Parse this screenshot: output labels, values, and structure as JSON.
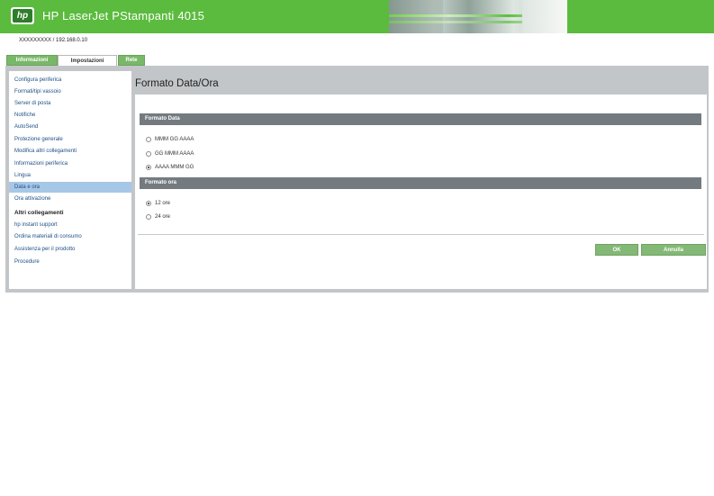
{
  "header": {
    "logo_text": "hp",
    "title": "HP LaserJet PStampanti 4015"
  },
  "device_address": "XXXXXXXXX / 192.168.0.10",
  "tabs": [
    {
      "label": "Informazioni"
    },
    {
      "label": "Impostazioni"
    },
    {
      "label": "Rete"
    }
  ],
  "sidebar": {
    "items": [
      {
        "label": "Configura periferica"
      },
      {
        "label": "Formati/tipi vassoio"
      },
      {
        "label": "Server di posta"
      },
      {
        "label": "Notifiche"
      },
      {
        "label": "AutoSend"
      },
      {
        "label": "Protezione generale"
      },
      {
        "label": "Modifica altri collegamenti"
      },
      {
        "label": "Informazioni periferica"
      },
      {
        "label": "Lingua"
      },
      {
        "label": "Data e ora"
      },
      {
        "label": "Ora attivazione"
      }
    ],
    "other_heading": "Altri collegamenti",
    "other_items": [
      {
        "label": "hp instant support"
      },
      {
        "label": "Ordina materiali di consumo"
      },
      {
        "label": "Assistenza per il prodotto"
      },
      {
        "label": "Procedure"
      }
    ]
  },
  "main": {
    "title": "Formato Data/Ora",
    "date_section": {
      "heading": "Formato Data",
      "options": [
        {
          "label": "MMM GG AAAA",
          "checked": false
        },
        {
          "label": "GG MMM AAAA",
          "checked": false
        },
        {
          "label": "AAAA MMM GG",
          "checked": true
        }
      ]
    },
    "time_section": {
      "heading": "Formato ora",
      "options": [
        {
          "label": "12 ore",
          "checked": true
        },
        {
          "label": "24 ore",
          "checked": false
        }
      ]
    },
    "ok_label": "OK",
    "cancel_label": "Annulla"
  }
}
